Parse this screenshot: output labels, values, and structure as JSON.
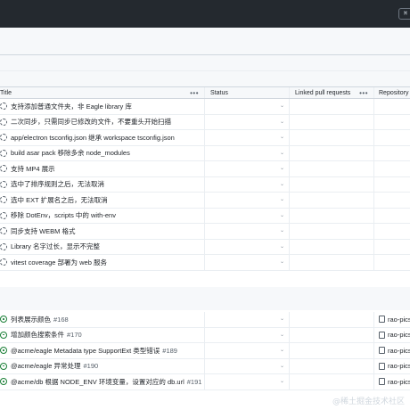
{
  "topbar": {
    "cmd_glyph": "⌘"
  },
  "columns": {
    "title": "Title",
    "status": "Status",
    "linked": "Linked pull requests",
    "repo": "Repository",
    "menu": "•••"
  },
  "drafts": [
    {
      "title": "支持添加普通文件夹，非 Eagle library 库"
    },
    {
      "title": "二次同步，只需同步已修改的文件，不要重头开始扫描"
    },
    {
      "title": "app/electron tsconfig.json 继承 workspace tsconfig.json"
    },
    {
      "title": "build asar pack 移除多余 node_modules"
    },
    {
      "title": "支持 MP4 展示"
    },
    {
      "title": "选中了排序规则之后，无法取消"
    },
    {
      "title": "选中 EXT 扩展名之后，无法取消"
    },
    {
      "title": "移除 DotEnv，scripts 中的 with-env"
    },
    {
      "title": "同步支持 WEBM 格式"
    },
    {
      "title": "Library 名字过长，显示不完整"
    },
    {
      "title": "vitest coverage 部署为 web 服务"
    }
  ],
  "issues": [
    {
      "title": "列表展示颜色",
      "number": "#168",
      "repo": "rao-pics/"
    },
    {
      "title": "增加颜色搜索条件",
      "number": "#170",
      "repo": "rao-pics/"
    },
    {
      "title": "@acme/eagle Metadata type SupportExt 类型错误",
      "number": "#189",
      "repo": "rao-pics/"
    },
    {
      "title": "@acme/eagle 异常处理",
      "number": "#190",
      "repo": "rao-pics/"
    },
    {
      "title": "@acme/db 根据 NODE_ENV 环境变量，设置对应的 db.url",
      "number": "#191",
      "repo": "rao-pics/"
    }
  ],
  "dropdown_glyph": "⌄",
  "watermark": "@稀土掘金技术社区"
}
